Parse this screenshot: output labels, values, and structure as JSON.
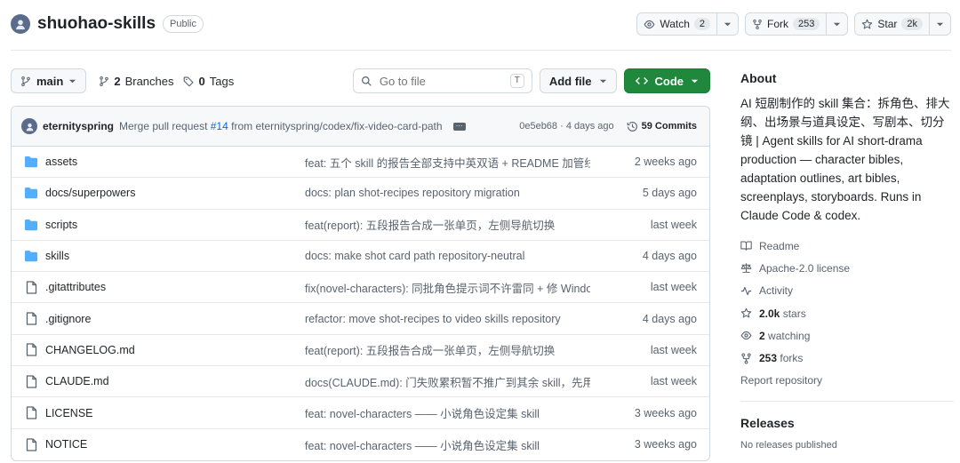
{
  "repo": {
    "name": "shuohao-skills",
    "visibility": "Public"
  },
  "header_actions": {
    "watch_label": "Watch",
    "watch_count": "2",
    "fork_label": "Fork",
    "fork_count": "253",
    "star_label": "Star",
    "star_count": "2k"
  },
  "toolbar": {
    "branch": "main",
    "branches_count": "2",
    "branches_label": "Branches",
    "tags_count": "0",
    "tags_label": "Tags",
    "search_placeholder": "Go to file",
    "search_shortcut": "T",
    "add_file_label": "Add file",
    "code_label": "Code"
  },
  "latest_commit": {
    "author": "eternityspring",
    "message_prefix": "Merge pull request ",
    "pr": "#14",
    "message_suffix": " from eternityspring/codex/fix-video-card-path",
    "hash_time": "0e5eb68 · 4 days ago",
    "commits_label": "59 Commits"
  },
  "files": [
    {
      "type": "folder",
      "name": "assets",
      "message": "feat: 五个 skill 的报告全部支持中英双语 + README 加管线流...",
      "date": "2 weeks ago"
    },
    {
      "type": "folder",
      "name": "docs/superpowers",
      "message": "docs: plan shot-recipes repository migration",
      "date": "5 days ago"
    },
    {
      "type": "folder",
      "name": "scripts",
      "message": "feat(report): 五段报告合成一张单页，左侧导航切换",
      "date": "last week"
    },
    {
      "type": "folder",
      "name": "skills",
      "message": "docs: make shot card path repository-neutral",
      "date": "4 days ago"
    },
    {
      "type": "file",
      "name": ".gitattributes",
      "message": "fix(novel-characters): 同批角色提示词不许雷同 + 修 Windows...",
      "date": "last week"
    },
    {
      "type": "file",
      "name": ".gitignore",
      "message": "refactor: move shot-recipes to video skills repository",
      "date": "4 days ago"
    },
    {
      "type": "file",
      "name": "CHANGELOG.md",
      "message": "feat(report): 五段报告合成一张单页，左侧导航切换",
      "date": "last week"
    },
    {
      "type": "file",
      "name": "CLAUDE.md",
      "message": "docs(CLAUDE.md): 门失败累积暂不推广到其余 skill，先用一...",
      "date": "last week"
    },
    {
      "type": "file",
      "name": "LICENSE",
      "message": "feat: novel-characters —— 小说角色设定集 skill",
      "date": "3 weeks ago"
    },
    {
      "type": "file",
      "name": "NOTICE",
      "message": "feat: novel-characters —— 小说角色设定集 skill",
      "date": "3 weeks ago"
    }
  ],
  "about": {
    "title": "About",
    "description": "AI 短剧制作的 skill 集合：拆角色、排大纲、出场景与道具设定、写剧本、切分镜 | Agent skills for AI short-drama production — character bibles, adaptation outlines, art bibles, screenplays, storyboards. Runs in Claude Code & codex.",
    "readme": "Readme",
    "license": "Apache-2.0 license",
    "activity": "Activity",
    "stars_count": "2.0k",
    "stars_label": "stars",
    "watching_count": "2",
    "watching_label": "watching",
    "forks_count": "253",
    "forks_label": "forks",
    "report": "Report repository"
  },
  "releases": {
    "title": "Releases",
    "note": "No releases published"
  },
  "colors": {
    "code_button": "#1f883d",
    "folder_icon": "#54aeff",
    "link": "#0969da"
  }
}
